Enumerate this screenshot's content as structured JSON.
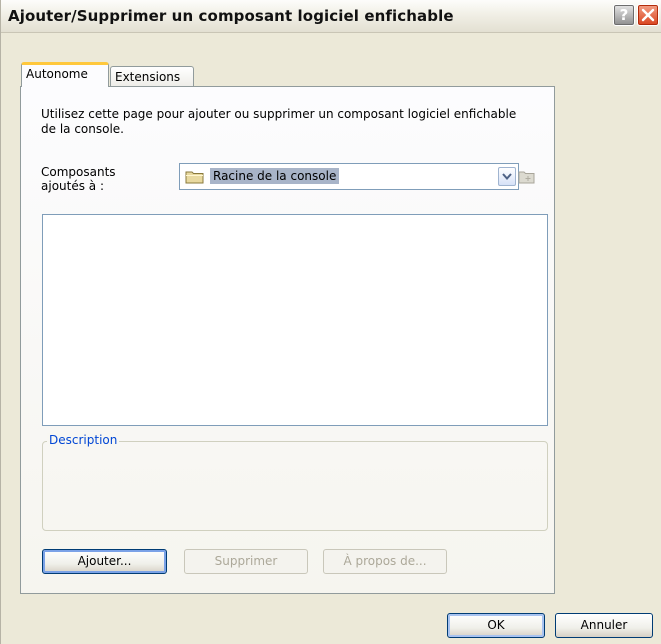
{
  "window": {
    "title": "Ajouter/Supprimer un composant logiciel enfichable",
    "help_glyph": "?",
    "close_glyph": "✕"
  },
  "tabs": [
    {
      "label": "Autonome",
      "active": true
    },
    {
      "label": "Extensions",
      "active": false
    }
  ],
  "standalone": {
    "intro_text": "Utilisez cette page pour ajouter ou supprimer un composant logiciel enfichable de la console.",
    "components_label": "Composants ajoutés à :",
    "combo_value": "Racine de la console",
    "combo_icon": "folder-icon",
    "list_items": [],
    "description_label": "Description",
    "description_text": "",
    "add_button": "Ajouter...",
    "remove_button": "Supprimer",
    "about_button": "À propos de..."
  },
  "footer": {
    "ok_label": "OK",
    "cancel_label": "Annuler"
  },
  "colors": {
    "dialog_bg": "#ece9d8",
    "tab_accent": "#ffc83c",
    "group_label": "#0046d5",
    "selection": "#a8b4c8"
  }
}
